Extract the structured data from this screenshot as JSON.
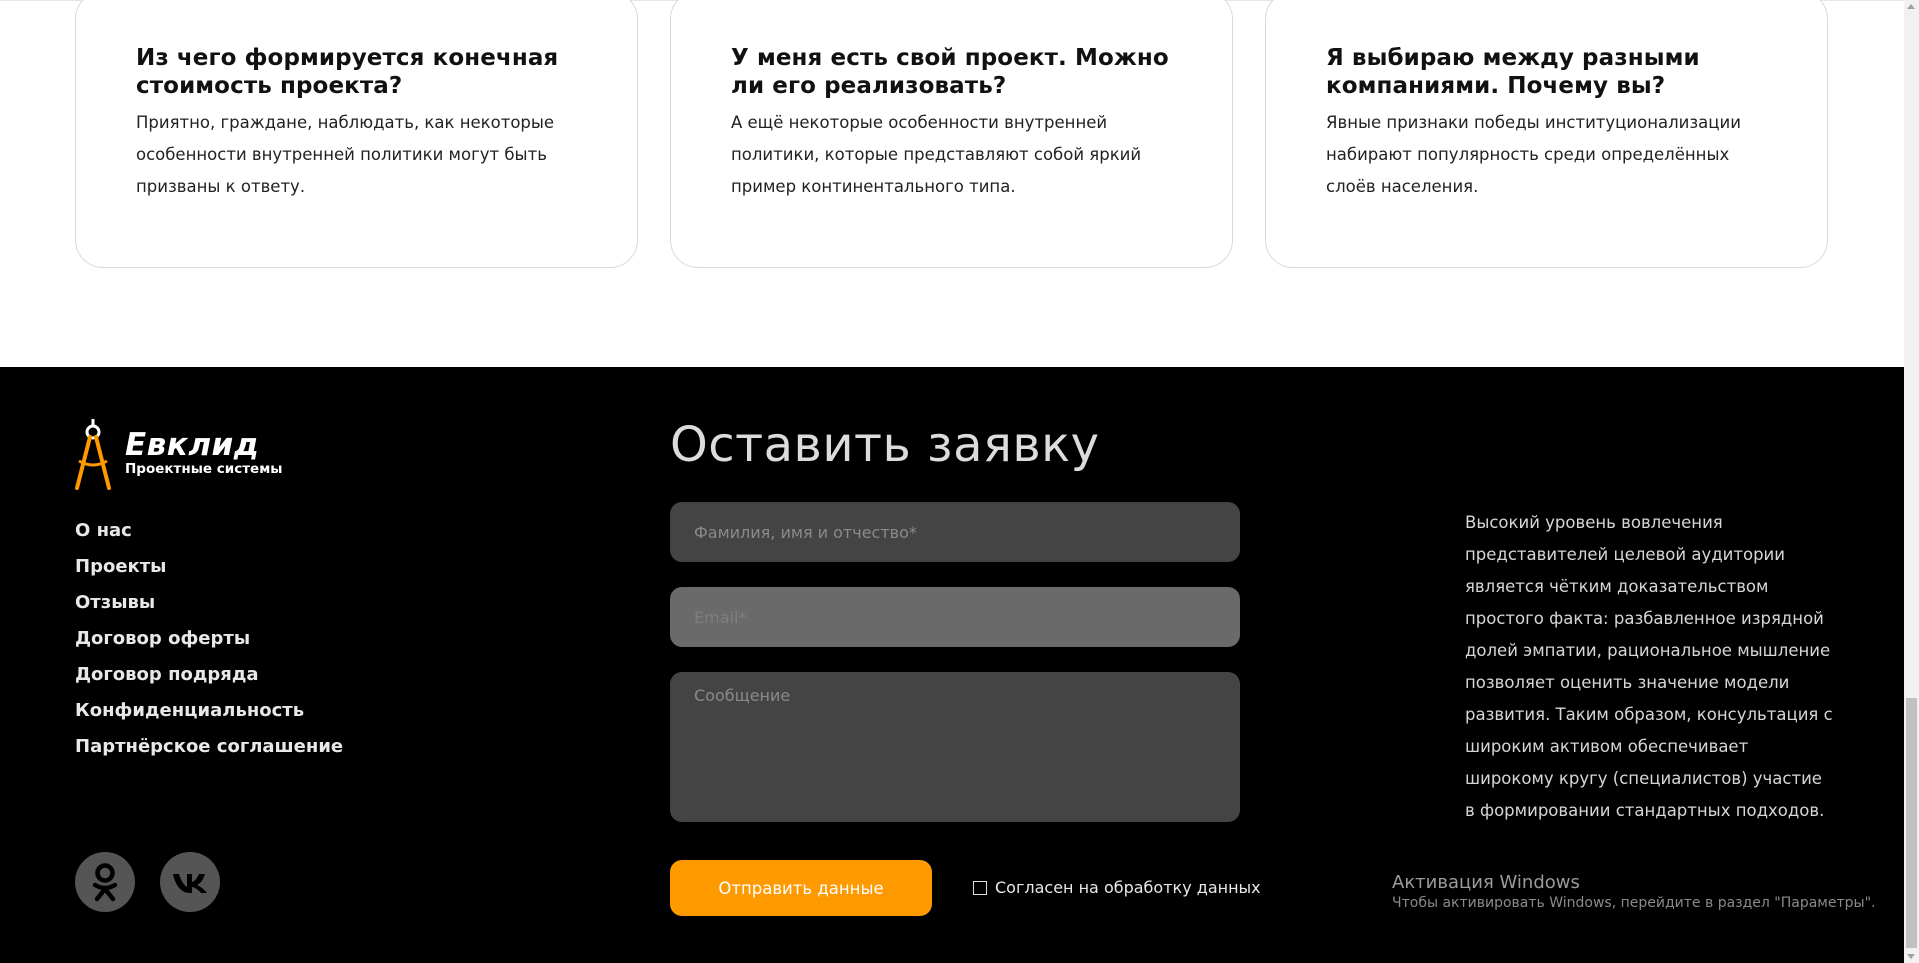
{
  "faq": {
    "cards": [
      {
        "title": "Из чего формируется конечная стоимость проекта?",
        "text": "Приятно, граждане, наблюдать, как некоторые особенности внутренней политики могут быть призваны к ответу."
      },
      {
        "title": "У меня есть свой проект. Можно ли его реализовать?",
        "text": "А ещё некоторые особенности внутренней политики, которые представляют собой яркий пример континентального типа."
      },
      {
        "title": "Я выбираю между разными компаниями. Почему вы?",
        "text": "Явные признаки победы институционализации набирают популярность среди определённых слоёв населения."
      }
    ]
  },
  "footer": {
    "logo": {
      "title": "Евклид",
      "subtitle": "Проектные системы",
      "icon": "compass-icon",
      "accent_color": "#ff9900"
    },
    "nav": [
      "О нас",
      "Проекты",
      "Отзывы",
      "Договор оферты",
      "Договор подряда",
      "Конфиденциальность",
      "Партнёрское соглашение"
    ],
    "social": [
      {
        "name": "odnoklassniki-icon"
      },
      {
        "name": "vk-icon"
      }
    ],
    "form": {
      "title": "Оставить заявку",
      "name_placeholder": "Фамилия, имя и отчество*",
      "email_placeholder": "Email*",
      "message_placeholder": "Сообщение",
      "submit_label": "Отправить данные",
      "consent_label": "Согласен на обработку данных",
      "button_color": "#ff9900"
    },
    "description": "Высокий уровень вовлечения представителей целевой аудитории является чётким доказательством простого факта: разбавленное изрядной долей эмпатии, рациональное мышление позволяет оценить значение модели развития. Таким образом, консультация с широким активом обеспечивает широкому кругу (специалистов) участие в формировании стандартных подходов."
  },
  "windows_activation": {
    "title": "Активация Windows",
    "subtitle": "Чтобы активировать Windows, перейдите в раздел \"Параметры\"."
  }
}
